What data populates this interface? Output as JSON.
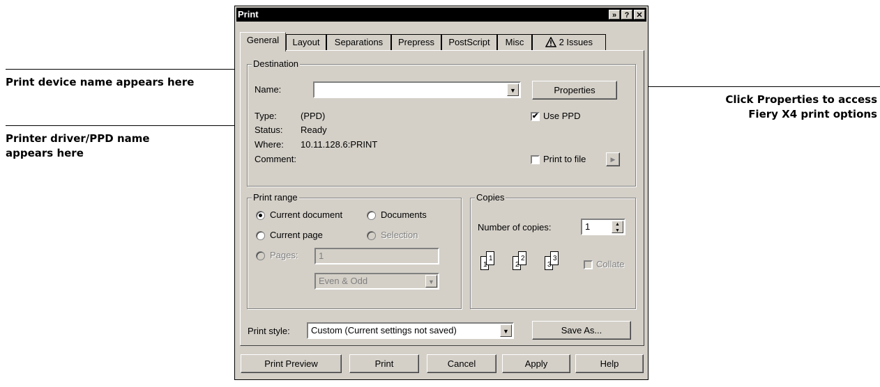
{
  "callouts": {
    "device_name": "Print device name appears here",
    "driver_line1": "Printer driver/PPD name",
    "driver_line2": "appears here",
    "properties_line1": "Click Properties to access",
    "properties_line2": "Fiery X4 print options"
  },
  "window": {
    "title": "Print",
    "title_buttons": [
      "»",
      "?",
      "✕"
    ]
  },
  "tabs": [
    "General",
    "Layout",
    "Separations",
    "Prepress",
    "PostScript",
    "Misc",
    "2 Issues"
  ],
  "destination": {
    "legend": "Destination",
    "name_label": "Name:",
    "name_value": "",
    "properties_button": "Properties",
    "type_label": "Type:",
    "type_value": "(PPD)",
    "status_label": "Status:",
    "status_value": "Ready",
    "where_label": "Where:",
    "where_value": "10.11.128.6:PRINT",
    "comment_label": "Comment:",
    "use_ppd_label": "Use PPD",
    "use_ppd_checked": true,
    "print_to_file_label": "Print to file",
    "print_to_file_checked": false
  },
  "print_range": {
    "legend": "Print range",
    "current_document": "Current document",
    "documents": "Documents",
    "current_page": "Current page",
    "selection": "Selection",
    "pages_label": "Pages:",
    "pages_value": "1",
    "subset_value": "Even & Odd",
    "selected": "current_document"
  },
  "copies": {
    "legend": "Copies",
    "number_label": "Number of copies:",
    "number_value": "1",
    "collate_label": "Collate",
    "collate_checked": false
  },
  "print_style": {
    "label": "Print style:",
    "value": "Custom (Current settings not saved)",
    "save_as_button": "Save As..."
  },
  "bottom_buttons": {
    "print_preview": "Print Preview",
    "print": "Print",
    "cancel": "Cancel",
    "apply": "Apply",
    "help": "Help"
  },
  "icons": {
    "warning": "warning-triangle-icon",
    "dropdown": "chevron-down-icon",
    "spinner": "spinner-icon",
    "arrow_right": "arrow-right-icon"
  }
}
